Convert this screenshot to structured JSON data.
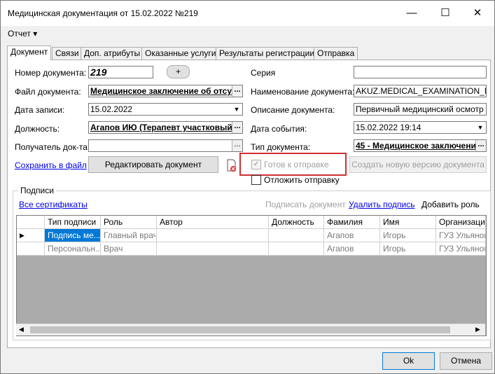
{
  "window": {
    "title": "Медицинская документация от 15.02.2022 №219",
    "minimize": "—",
    "maximize": "☐",
    "close": "✕"
  },
  "menu": {
    "report": "Отчет ▾"
  },
  "tabs": [
    "Документ",
    "Связи",
    "Доп. атрибуты",
    "Оказанные услуги",
    "Результаты регистрации",
    "Отправка"
  ],
  "form": {
    "doc_number_label": "Номер документа:",
    "doc_number_value": "219",
    "add_btn": "+",
    "file_label": "Файл документа:",
    "file_value": "Медицинское заключение об отсу",
    "date_label": "Дата записи:",
    "date_value": "15.02.2022",
    "position_label": "Должность:",
    "position_value": "Агапов ИЮ (Терапевт участковый)",
    "recipient_label": "Получатель док-та",
    "recipient_value": "",
    "series_label": "Серия",
    "series_value": "",
    "docname_label": "Наименование документа:",
    "docname_value": "AKUZ.MEDICAL_EXAMINATION_MAI",
    "desc_label": "Описание документа:",
    "desc_value": "Первичный медицинский осмотр",
    "event_label": "Дата события:",
    "event_value": "15.02.2022 19:14",
    "doctype_label": "Тип документа:",
    "doctype_value": "45 - Медицинское заключени",
    "ellipsis": "..."
  },
  "actions": {
    "save_link": "Сохранить в файл",
    "edit_btn": "Редактировать документ",
    "ready_label": "Готов к отправке",
    "new_version_btn": "Создать новую версию документа",
    "postpone_label": "Отложить отправку"
  },
  "signatures": {
    "group_label": "Подписи",
    "all_certs": "Все сертификаты",
    "sign_btn": "Подписать документ",
    "delete_link": "Удалить подпись",
    "add_role_btn": "Добавить роль",
    "columns": [
      "Тип подписи",
      "Роль",
      "Автор",
      "Должность",
      "Фамилия",
      "Имя",
      "Организация"
    ],
    "rows": [
      [
        "Подпись ме...",
        "Главный врач",
        "",
        "",
        "Агапов",
        "Игорь",
        "ГУЗ Ульянов"
      ],
      [
        "Персональн...",
        "Врач",
        "",
        "",
        "Агапов",
        "Игорь",
        "ГУЗ Ульянов"
      ]
    ]
  },
  "footer": {
    "ok": "Ok",
    "cancel": "Отмена"
  }
}
